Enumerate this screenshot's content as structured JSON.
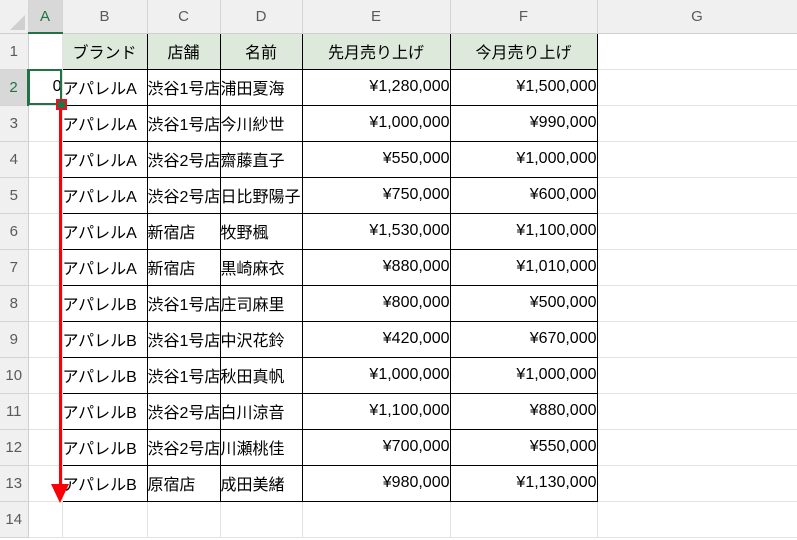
{
  "app": {
    "name": "excel-spreadsheet",
    "accent_color": "#217346",
    "table_header_fill": "#ddeadb",
    "drag_indicator_color": "#fb0007"
  },
  "column_headers": [
    "A",
    "B",
    "C",
    "D",
    "E",
    "F",
    "G"
  ],
  "row_headers": [
    "1",
    "2",
    "3",
    "4",
    "5",
    "6",
    "7",
    "8",
    "9",
    "10",
    "11",
    "12",
    "13",
    "14"
  ],
  "active_cell": {
    "reference": "A2",
    "value": "0",
    "column": "A",
    "row": "2"
  },
  "table": {
    "header_row_index": 1,
    "columns": [
      "",
      "ブランド",
      "店舗",
      "名前",
      "先月売り上げ",
      "今月売り上げ"
    ],
    "rows": [
      {
        "row": "2",
        "a": "0",
        "brand": "アパレルA",
        "store": "渋谷1号店",
        "name": "浦田夏海",
        "last_month": "¥1,280,000",
        "this_month": "¥1,500,000"
      },
      {
        "row": "3",
        "a": "",
        "brand": "アパレルA",
        "store": "渋谷1号店",
        "name": "今川紗世",
        "last_month": "¥1,000,000",
        "this_month": "¥990,000"
      },
      {
        "row": "4",
        "a": "",
        "brand": "アパレルA",
        "store": "渋谷2号店",
        "name": "齋藤直子",
        "last_month": "¥550,000",
        "this_month": "¥1,000,000"
      },
      {
        "row": "5",
        "a": "",
        "brand": "アパレルA",
        "store": "渋谷2号店",
        "name": "日比野陽子",
        "last_month": "¥750,000",
        "this_month": "¥600,000"
      },
      {
        "row": "6",
        "a": "",
        "brand": "アパレルA",
        "store": "新宿店",
        "name": "牧野楓",
        "last_month": "¥1,530,000",
        "this_month": "¥1,100,000"
      },
      {
        "row": "7",
        "a": "",
        "brand": "アパレルA",
        "store": "新宿店",
        "name": "黒崎麻衣",
        "last_month": "¥880,000",
        "this_month": "¥1,010,000"
      },
      {
        "row": "8",
        "a": "",
        "brand": "アパレルB",
        "store": "渋谷1号店",
        "name": "庄司麻里",
        "last_month": "¥800,000",
        "this_month": "¥500,000"
      },
      {
        "row": "9",
        "a": "",
        "brand": "アパレルB",
        "store": "渋谷1号店",
        "name": "中沢花鈴",
        "last_month": "¥420,000",
        "this_month": "¥670,000"
      },
      {
        "row": "10",
        "a": "",
        "brand": "アパレルB",
        "store": "渋谷1号店",
        "name": "秋田真帆",
        "last_month": "¥1,000,000",
        "this_month": "¥1,000,000"
      },
      {
        "row": "11",
        "a": "",
        "brand": "アパレルB",
        "store": "渋谷2号店",
        "name": "白川涼音",
        "last_month": "¥1,100,000",
        "this_month": "¥880,000"
      },
      {
        "row": "12",
        "a": "",
        "brand": "アパレルB",
        "store": "渋谷2号店",
        "name": "川瀬桃佳",
        "last_month": "¥700,000",
        "this_month": "¥550,000"
      },
      {
        "row": "13",
        "a": "",
        "brand": "アパレルB",
        "store": "原宿店",
        "name": "成田美緒",
        "last_month": "¥980,000",
        "this_month": "¥1,130,000"
      }
    ]
  },
  "annotations": {
    "fill_drag": {
      "name": "fill-handle-drag",
      "from_cell": "A2",
      "to_cell": "A13"
    }
  }
}
